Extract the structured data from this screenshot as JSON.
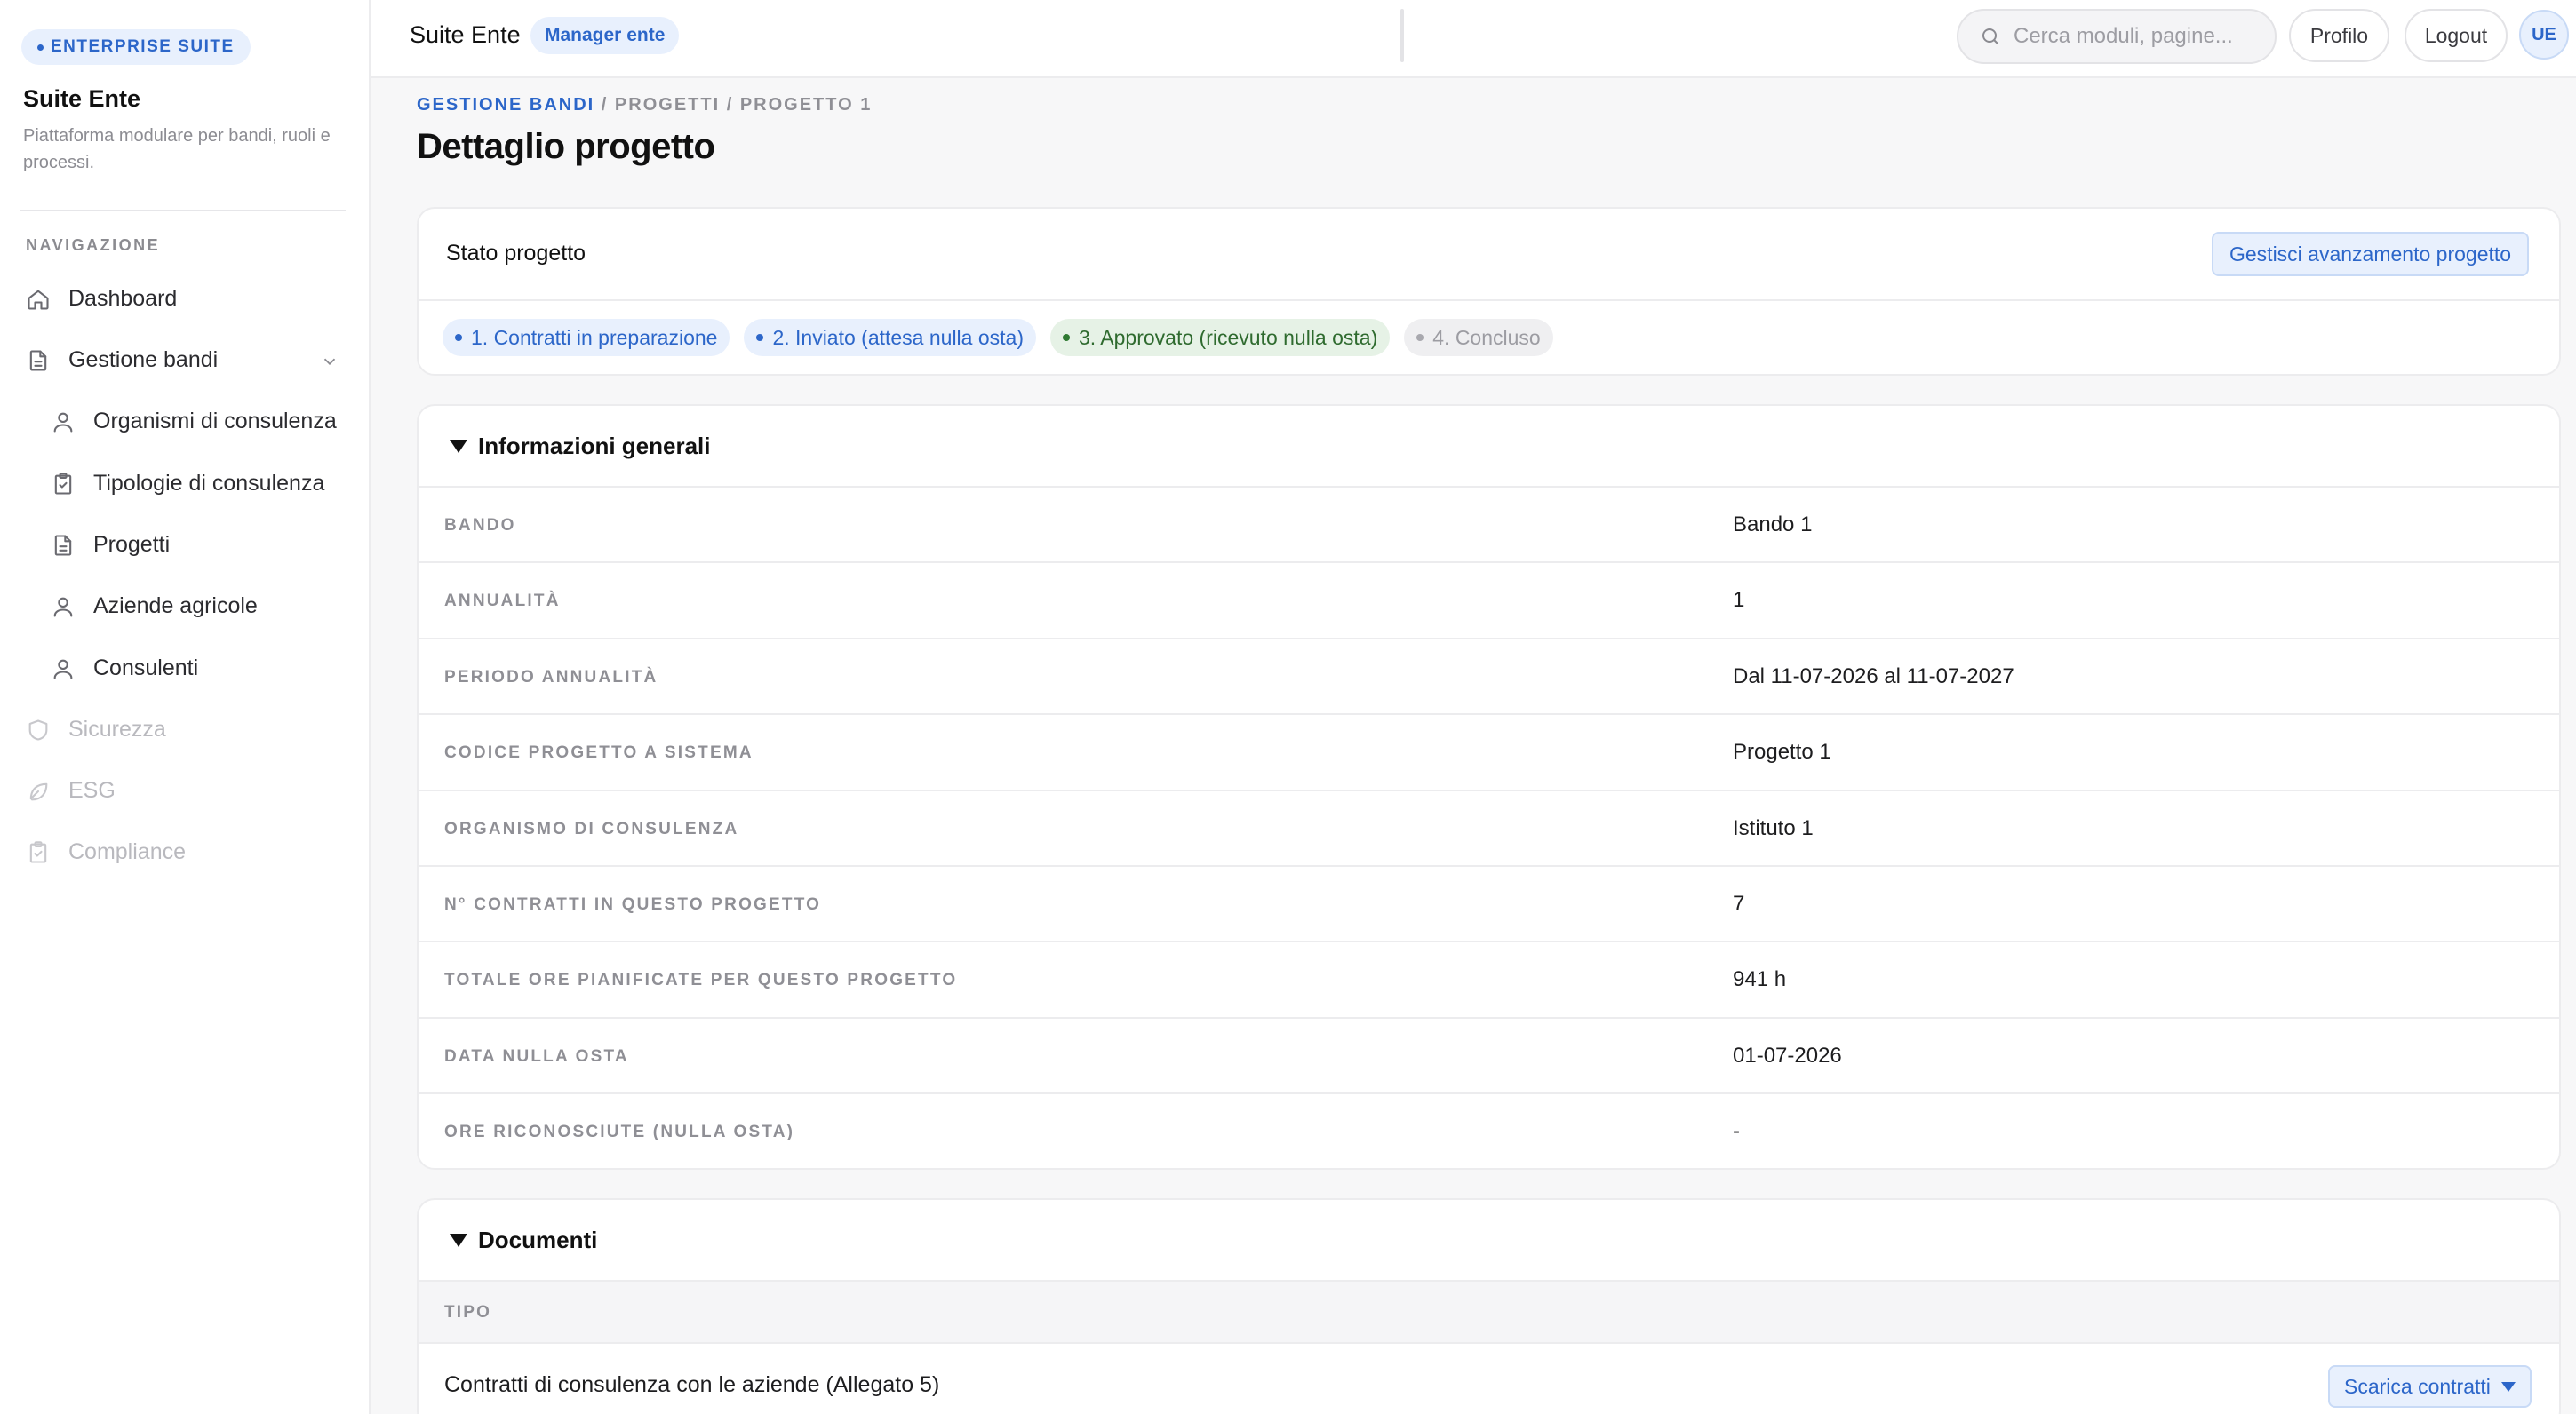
{
  "sidebar": {
    "brand_badge": "ENTERPRISE SUITE",
    "app_name": "Suite Ente",
    "app_description": "Piattaforma modulare per bandi, ruoli e processi.",
    "nav_heading": "NAVIGAZIONE",
    "items": [
      {
        "label": "Dashboard",
        "icon": "home-icon"
      },
      {
        "label": "Gestione bandi",
        "icon": "document-icon",
        "expanded": true
      },
      {
        "label": "Organismi di consulenza",
        "icon": "user-icon"
      },
      {
        "label": "Tipologie di consulenza",
        "icon": "clipboard-icon"
      },
      {
        "label": "Progetti",
        "icon": "document-icon"
      },
      {
        "label": "Aziende agricole",
        "icon": "user-icon"
      },
      {
        "label": "Consulenti",
        "icon": "user-icon"
      },
      {
        "label": "Sicurezza",
        "icon": "shield-icon",
        "disabled": true
      },
      {
        "label": "ESG",
        "icon": "leaf-icon",
        "disabled": true
      },
      {
        "label": "Compliance",
        "icon": "clipboard-icon",
        "disabled": true
      }
    ]
  },
  "topbar": {
    "title": "Suite Ente",
    "role_badge": "Manager ente",
    "search_placeholder": "Cerca moduli, pagine...",
    "profile_label": "Profilo",
    "logout_label": "Logout",
    "avatar_initials": "UE"
  },
  "breadcrumb": {
    "link": "GESTIONE BANDI",
    "rest": " / PROGETTI / PROGETTO 1"
  },
  "page_title": "Dettaglio progetto",
  "status": {
    "title": "Stato progetto",
    "manage_button": "Gestisci avanzamento progetto",
    "steps": [
      {
        "label": "1. Contratti in preparazione",
        "state": "blue"
      },
      {
        "label": "2. Inviato (attesa nulla osta)",
        "state": "blue"
      },
      {
        "label": "3. Approvato (ricevuto nulla osta)",
        "state": "green"
      },
      {
        "label": "4. Concluso",
        "state": "grey"
      }
    ]
  },
  "info": {
    "title": "Informazioni generali",
    "rows": [
      {
        "label": "BANDO",
        "value": "Bando 1"
      },
      {
        "label": "ANNUALITÀ",
        "value": "1"
      },
      {
        "label": "PERIODO ANNUALITÀ",
        "value": "Dal 11-07-2026 al 11-07-2027"
      },
      {
        "label": "CODICE PROGETTO A SISTEMA",
        "value": "Progetto 1"
      },
      {
        "label": "ORGANISMO DI CONSULENZA",
        "value": "Istituto 1"
      },
      {
        "label": "N° CONTRATTI IN QUESTO PROGETTO",
        "value": "7"
      },
      {
        "label": "TOTALE ORE PIANIFICATE PER QUESTO PROGETTO",
        "value": "941 h"
      },
      {
        "label": "DATA NULLA OSTA",
        "value": "01-07-2026"
      },
      {
        "label": "ORE RICONOSCIUTE (NULLA OSTA)",
        "value": "-"
      }
    ]
  },
  "documents": {
    "title": "Documenti",
    "column_header": "TIPO",
    "rows": [
      {
        "type": "Contratti di consulenza con le aziende (Allegato 5)",
        "action": "Scarica contratti"
      }
    ]
  },
  "colors": {
    "accent": "#2c66c9",
    "accent_bg": "#e8f0fd",
    "success": "#2f6b2f",
    "success_bg": "#e6f2e6",
    "muted": "#9c9ca2"
  }
}
